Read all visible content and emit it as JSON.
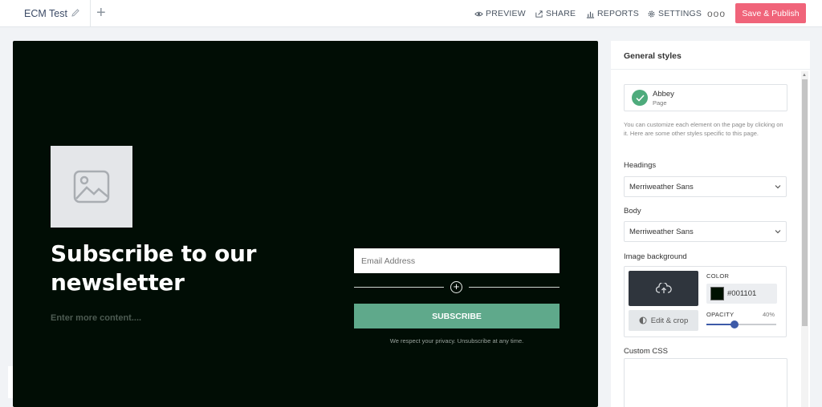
{
  "header": {
    "title": "ECM Test",
    "nav": [
      {
        "label": "PREVIEW",
        "icon": "eye-icon"
      },
      {
        "label": "SHARE",
        "icon": "share-icon"
      },
      {
        "label": "REPORTS",
        "icon": "bar-chart-icon"
      },
      {
        "label": "SETTINGS",
        "icon": "gear-icon"
      }
    ],
    "more": "ooo",
    "publish_label": "Save & Publish"
  },
  "canvas": {
    "headline": "Subscribe to our newsletter",
    "subcontent": "Enter more content....",
    "email_placeholder": "Email Address",
    "subscribe_label": "SUBSCRIBE",
    "privacy_text": "We respect your privacy. Unsubscribe at any time.",
    "background_color": "#001101"
  },
  "panel": {
    "title": "General styles",
    "theme": {
      "name": "Abbey",
      "type": "Page"
    },
    "help_text": "You can customize each element on the page by clicking on it. Here are some other styles specific to this page.",
    "headings_label": "Headings",
    "headings_font": "Merriweather Sans",
    "body_label": "Body",
    "body_font": "Merriweather Sans",
    "image_bg_label": "Image background",
    "edit_crop_label": "Edit & crop",
    "color_label": "COLOR",
    "color_value": "#001101",
    "opacity_label": "OPACITY",
    "opacity_value": "40%",
    "opacity_fraction": 0.4,
    "custom_css_label": "Custom CSS"
  }
}
